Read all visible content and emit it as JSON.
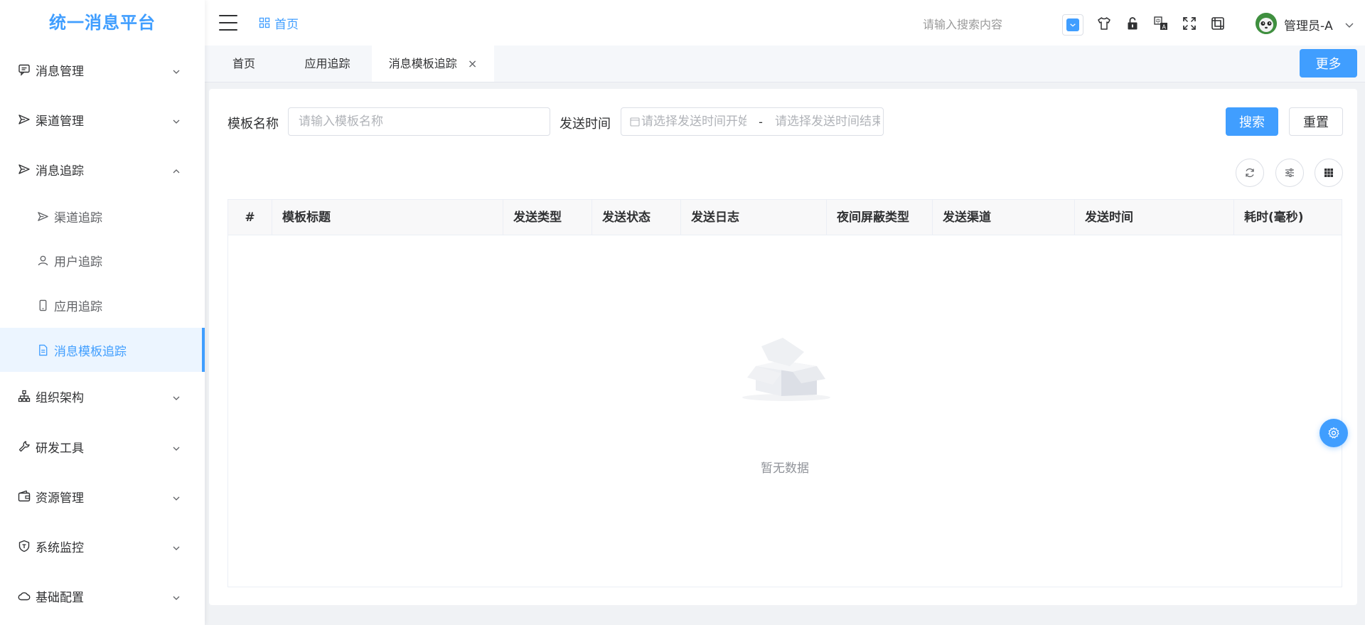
{
  "app": {
    "title": "统一消息平台"
  },
  "sidebar": {
    "items": [
      {
        "label": "消息管理",
        "icon": "message-icon",
        "expanded": false
      },
      {
        "label": "渠道管理",
        "icon": "send-icon",
        "expanded": false
      },
      {
        "label": "消息追踪",
        "icon": "send-icon",
        "expanded": true
      },
      {
        "label": "组织架构",
        "icon": "org-icon",
        "expanded": false
      },
      {
        "label": "研发工具",
        "icon": "tool-icon",
        "expanded": false
      },
      {
        "label": "资源管理",
        "icon": "wallet-icon",
        "expanded": false
      },
      {
        "label": "系统监控",
        "icon": "shield-icon",
        "expanded": false
      },
      {
        "label": "基础配置",
        "icon": "cloud-icon",
        "expanded": false
      }
    ],
    "sub_items": [
      {
        "label": "渠道追踪",
        "icon": "send-icon",
        "active": false
      },
      {
        "label": "用户追踪",
        "icon": "user-icon",
        "active": false
      },
      {
        "label": "应用追踪",
        "icon": "mobile-icon",
        "active": false
      },
      {
        "label": "消息模板追踪",
        "icon": "document-icon",
        "active": true
      }
    ]
  },
  "header": {
    "breadcrumb": "首页",
    "search_placeholder": "请输入搜索内容",
    "user_name": "管理员-A",
    "icons": [
      "check-icon",
      "tshirt-icon",
      "lock-icon",
      "translate-icon",
      "fullscreen-icon",
      "screenshot-icon"
    ]
  },
  "tabs": {
    "items": [
      {
        "label": "首页",
        "active": false
      },
      {
        "label": "应用追踪",
        "active": false
      },
      {
        "label": "消息模板追踪",
        "active": true,
        "closable": true
      }
    ],
    "close_symbol": "×",
    "more_label": "更多"
  },
  "search_form": {
    "template_name_label": "模板名称",
    "template_name_placeholder": "请输入模板名称",
    "send_time_label": "发送时间",
    "start_placeholder": "请选择发送时间开始",
    "end_placeholder": "请选择发送时间结束",
    "range_separator": "-",
    "search_label": "搜索",
    "reset_label": "重置"
  },
  "table": {
    "columns": [
      "#",
      "模板标题",
      "发送类型",
      "发送状态",
      "发送日志",
      "夜间屏蔽类型",
      "发送渠道",
      "发送时间",
      "耗时(毫秒)"
    ],
    "rows": [],
    "empty_text": "暂无数据"
  },
  "colors": {
    "primary": "#409eff",
    "active_bg": "#ecf5ff"
  }
}
